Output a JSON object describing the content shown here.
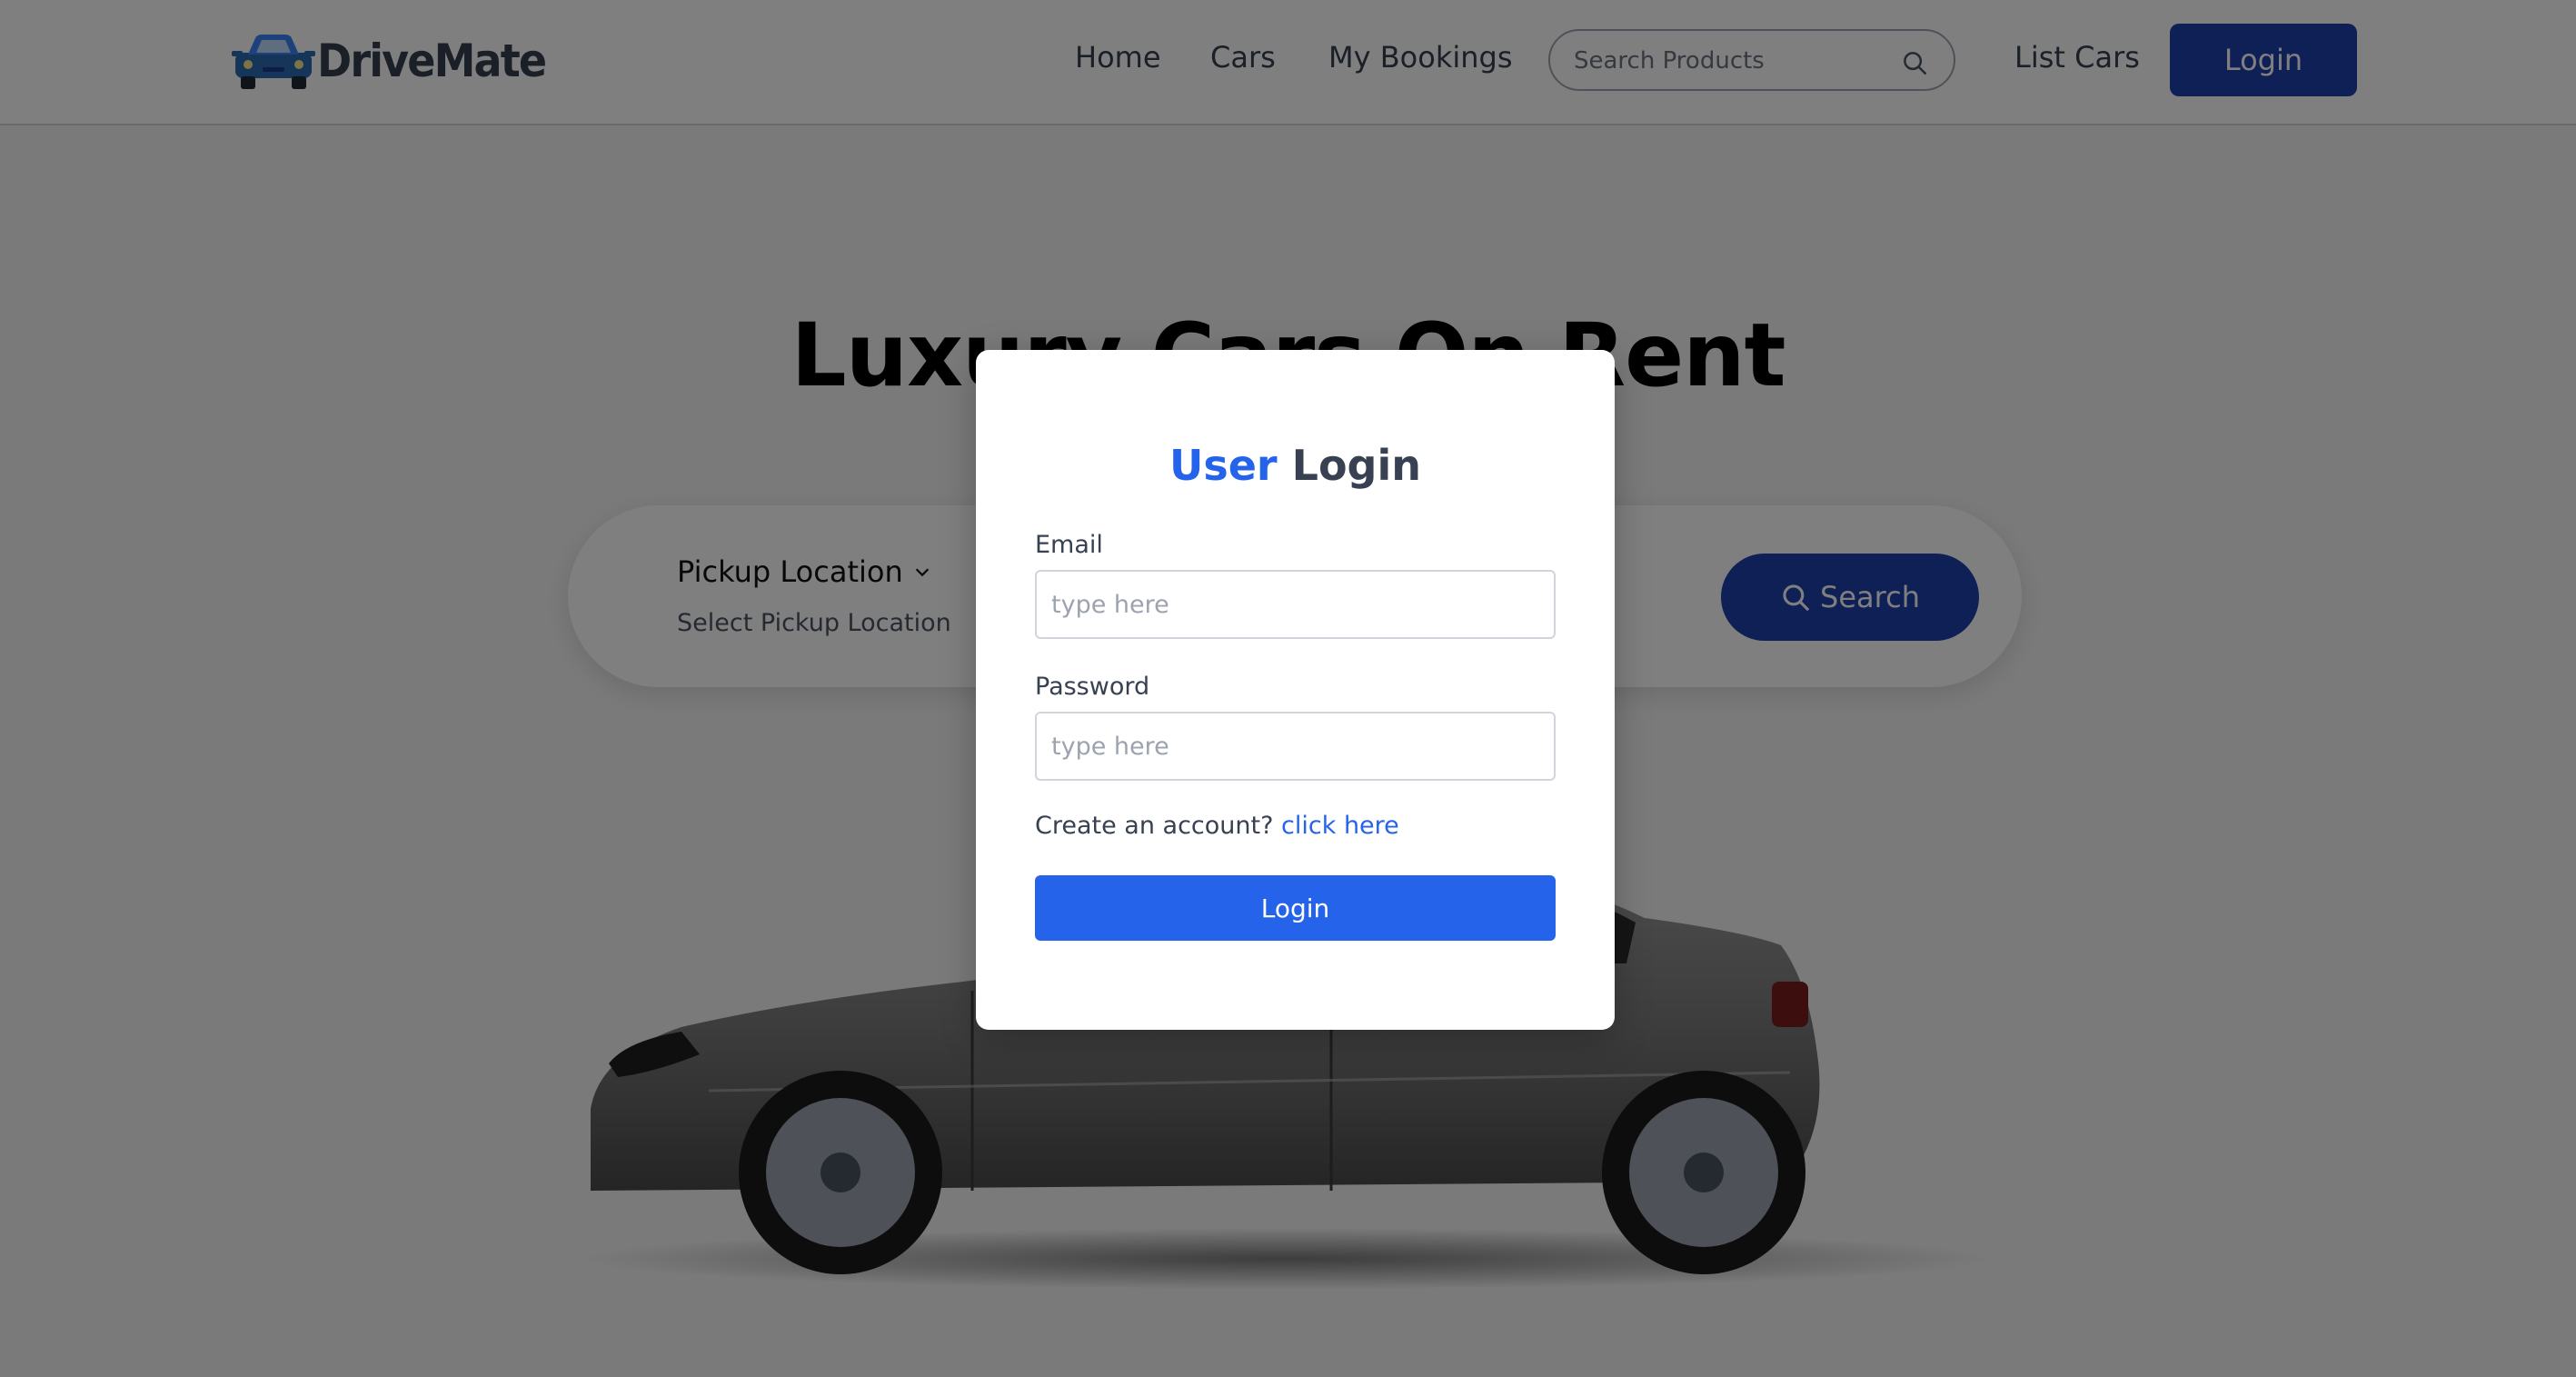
{
  "brand": {
    "name": "DriveMate"
  },
  "nav": {
    "links": [
      "Home",
      "Cars",
      "My Bookings"
    ],
    "search_placeholder": "Search Products",
    "list_cars": "List Cars",
    "login": "Login"
  },
  "hero": {
    "title": "Luxury Cars On Rent",
    "pickup_label": "Pickup Location",
    "pickup_placeholder": "Select Pickup Location",
    "search_button": "Search"
  },
  "modal": {
    "title_accent": "User",
    "title_rest": "Login",
    "email_label": "Email",
    "email_placeholder": "type here",
    "password_label": "Password",
    "password_placeholder": "type here",
    "create_text": "Create an account?",
    "create_link": "click here",
    "submit": "Login"
  },
  "colors": {
    "primary": "#2563eb",
    "nav_button": "#1e40af",
    "overlay": "rgba(0,0,0,0.5)"
  }
}
